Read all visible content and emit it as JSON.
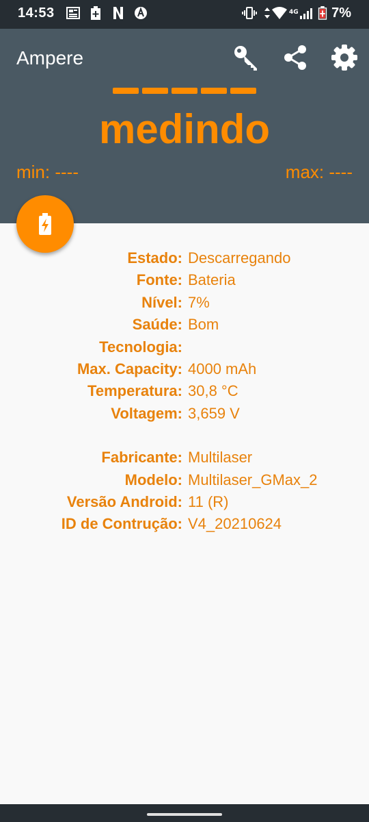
{
  "status_bar": {
    "time": "14:53",
    "battery_percent": "7%"
  },
  "app": {
    "title": "Ampere",
    "icons": [
      "key-icon",
      "share-icon",
      "settings-icon"
    ]
  },
  "meter": {
    "reading": "medindo",
    "min_label": "min: ----",
    "max_label": "max: ----"
  },
  "colors": {
    "header": "#4a5963",
    "accent": "#ff8c00",
    "status_bar": "#262d33"
  },
  "battery_info": [
    {
      "label": "Estado:",
      "value": "Descarregando"
    },
    {
      "label": "Fonte:",
      "value": "Bateria"
    },
    {
      "label": "Nível:",
      "value": "7%"
    },
    {
      "label": "Saúde:",
      "value": "Bom"
    },
    {
      "label": "Tecnologia:",
      "value": ""
    },
    {
      "label": "Max. Capacity:",
      "value": "4000 mAh"
    },
    {
      "label": "Temperatura:",
      "value": "30,8 °C"
    },
    {
      "label": "Voltagem:",
      "value": "3,659 V"
    }
  ],
  "device_info": [
    {
      "label": "Fabricante:",
      "value": "Multilaser"
    },
    {
      "label": "Modelo:",
      "value": "Multilaser_GMax_2"
    },
    {
      "label": "Versão Android:",
      "value": "11 (R)"
    },
    {
      "label": "ID de Contrução:",
      "value": "V4_20210624"
    }
  ]
}
